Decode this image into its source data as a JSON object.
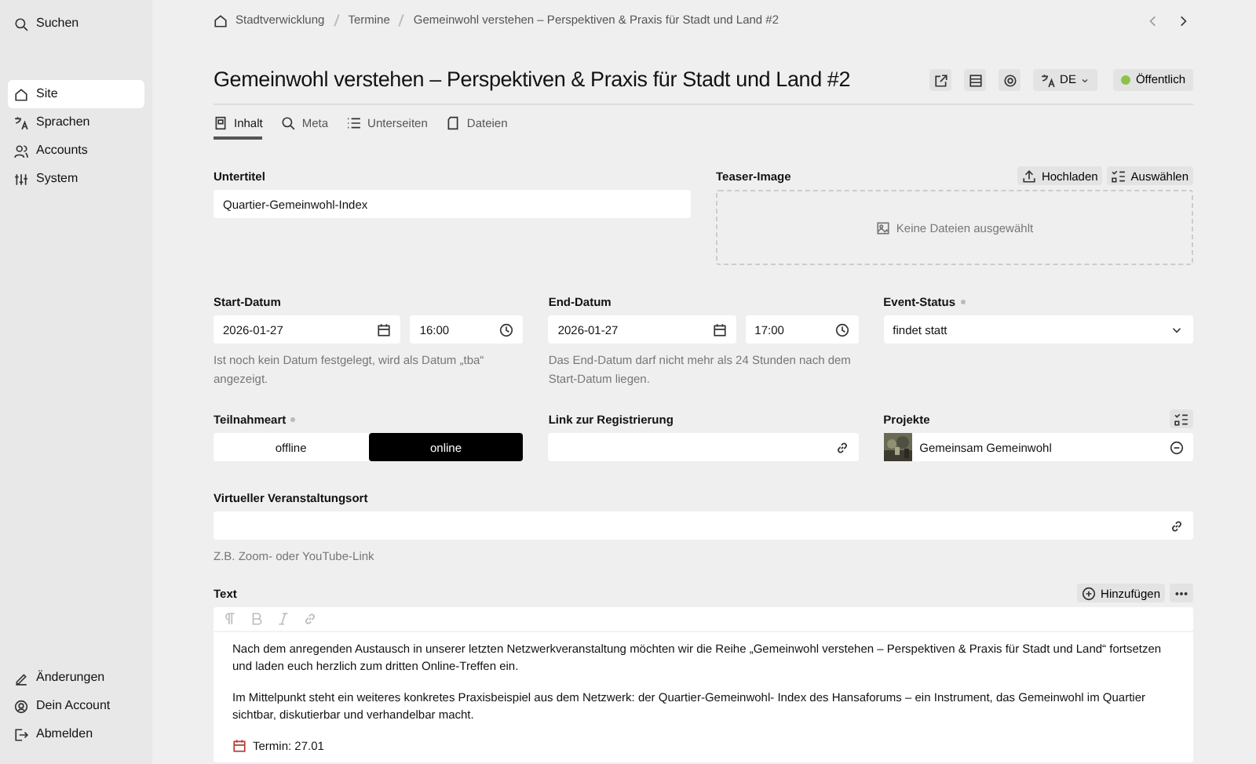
{
  "sidebar": {
    "search": "Suchen",
    "items": [
      {
        "label": "Site",
        "selected": true
      },
      {
        "label": "Sprachen",
        "selected": false
      },
      {
        "label": "Accounts",
        "selected": false
      },
      {
        "label": "System",
        "selected": false
      }
    ],
    "footer": [
      "Änderungen",
      "Dein Account",
      "Abmelden"
    ]
  },
  "breadcrumb": [
    "Stadtverwicklung",
    "Termine",
    "Gemeinwohl verstehen – Perspektiven & Praxis für Stadt und Land #2"
  ],
  "title": "Gemeinwohl verstehen – Perspektiven & Praxis für Stadt und Land #2",
  "header_actions": {
    "language": "DE",
    "status": "Öffentlich",
    "published": true
  },
  "tabs": [
    {
      "label": "Inhalt",
      "selected": true
    },
    {
      "label": "Meta",
      "selected": false
    },
    {
      "label": "Unterseiten",
      "selected": false
    },
    {
      "label": "Dateien",
      "selected": false
    }
  ],
  "fields": {
    "subtitle": {
      "label": "Untertitel",
      "value": "Quartier-Gemeinwohl-Index"
    },
    "teaser": {
      "label": "Teaser-Image",
      "upload": "Hochladen",
      "select": "Auswählen",
      "empty": "Keine Dateien ausgewählt"
    },
    "start": {
      "label": "Start-Datum",
      "date": "2026-01-27",
      "time": "16:00",
      "help": "Ist noch kein Datum festgelegt, wird als Datum „tba“ angezeigt."
    },
    "end": {
      "label": "End-Datum",
      "date": "2026-01-27",
      "time": "17:00",
      "help": "Das End-Datum darf nicht mehr als 24 Stunden nach dem Start-Datum liegen."
    },
    "event_status": {
      "label": "Event-Status",
      "required": true,
      "value": "findet statt"
    },
    "participation": {
      "label": "Teilnahmeart",
      "required": true,
      "options": [
        {
          "label": "offline",
          "selected": false
        },
        {
          "label": "online",
          "selected": true
        }
      ]
    },
    "registration": {
      "label": "Link zur Registrierung"
    },
    "projects": {
      "label": "Projekte",
      "items": [
        {
          "label": "Gemeinsam Gemeinwohl",
          "kind": "picture"
        }
      ]
    },
    "virtual": {
      "label": "Virtueller Veranstaltungsort",
      "help": "Z.B. Zoom- oder YouTube-Link"
    },
    "text": {
      "label": "Text",
      "add": "Hinzufügen",
      "paragraphs": [
        "Nach dem anregenden Austausch in unserer letzten Netzwerkveranstaltung möchten wir die Reihe „Gemeinwohl verstehen – Perspektiven & Praxis für Stadt und Land“ fortsetzen und laden euch herzlich zum dritten Online-Treffen ein.",
        "Im Mittelpunkt steht ein weiteres konkretes Praxisbeispiel aus dem Netzwerk: der Quartier-Gemeinwohl- Index des Hansaforums – ein Instrument, das Gemeinwohl im Quartier sichtbar, diskutierbar und verhandelbar macht.",
        "Termin: 27.01"
      ]
    }
  }
}
